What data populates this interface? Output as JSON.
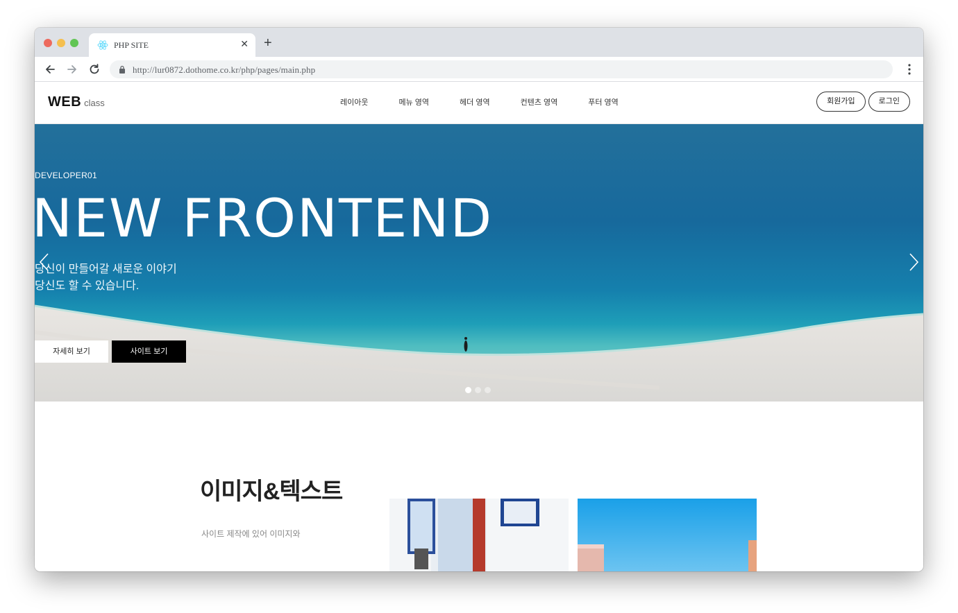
{
  "browser": {
    "tab_title": "PHP SITE",
    "url": "http://lur0872.dothome.co.kr/php/pages/main.php"
  },
  "header": {
    "logo_main": "WEB",
    "logo_sub": "class",
    "nav": [
      "레이아웃",
      "메뉴 영역",
      "헤더 영역",
      "컨텐츠 영역",
      "푸터 영역"
    ],
    "join_label": "회원가입",
    "login_label": "로그인"
  },
  "hero": {
    "kicker": "DEVELOPER01",
    "title": "NEW FRONTEND",
    "desc_line1": "당신이 만들어갈 새로운 이야기",
    "desc_line2": "당신도 할 수 있습니다.",
    "detail_label": "자세히 보기",
    "site_label": "사이트 보기",
    "slide_index": 1,
    "slide_count": 3
  },
  "section": {
    "title": "이미지&텍스트",
    "desc": "사이트 제작에 있어 이미지와"
  },
  "colors": {
    "accent_black": "#000000",
    "sea": "#1a6a9a",
    "chrome": "#dee1e6"
  }
}
